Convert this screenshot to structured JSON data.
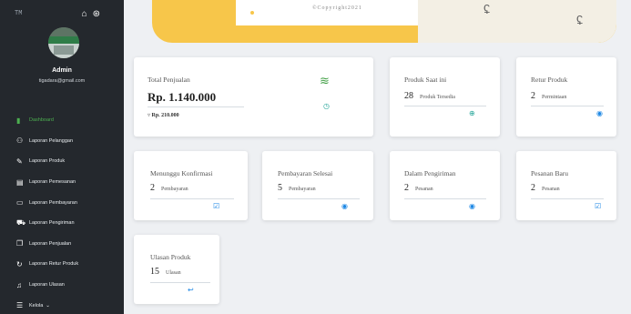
{
  "sidebar": {
    "brand": "TM",
    "top_icons": [
      "home-icon",
      "user-circle-icon"
    ],
    "user": {
      "name": "Admin",
      "email": "tigadara@gmail.com"
    },
    "items": [
      {
        "label": "Dashboard",
        "icon": "chart-bars-icon",
        "active": true
      },
      {
        "label": "Laporan Pelanggan",
        "icon": "users-icon"
      },
      {
        "label": "Laporan Produk",
        "icon": "edit-icon"
      },
      {
        "label": "Laporan Pemesanan",
        "icon": "file-icon"
      },
      {
        "label": "Laporan Pembayaran",
        "icon": "wallet-icon"
      },
      {
        "label": "Laporan Pengiriman",
        "icon": "truck-icon"
      },
      {
        "label": "Laporan Penjualan",
        "icon": "copy-icon"
      },
      {
        "label": "Laporan Retur Produk",
        "icon": "refresh-icon"
      },
      {
        "label": "Laporan Ulasan",
        "icon": "bell-icon"
      },
      {
        "label": "Kelola",
        "icon": "list-icon",
        "suffix": "⌄"
      }
    ]
  },
  "banner": {
    "copyright": "©Copyright2021"
  },
  "cards": {
    "total_penjualan": {
      "title": "Total Penjualan",
      "value": "Rp. 1.140.000",
      "sub": "Rp. 210.000"
    },
    "produk": {
      "title": "Produk Saat ini",
      "value": "28",
      "unit": "Produk Tersedia"
    },
    "retur": {
      "title": "Retur Produk",
      "value": "2",
      "unit": "Permintaan"
    },
    "menunggu": {
      "title": "Menunggu Konfirmasi",
      "value": "2",
      "unit": "Pembayaran"
    },
    "pembayaran": {
      "title": "Pembayaran Selesai",
      "value": "5",
      "unit": "Pembayaran"
    },
    "pengiriman": {
      "title": "Dalam Pengiriman",
      "value": "2",
      "unit": "Pesanan"
    },
    "pesanan_baru": {
      "title": "Pesanan Baru",
      "value": "2",
      "unit": "Pesanan"
    },
    "ulasan": {
      "title": "Ulasan Produk",
      "value": "15",
      "unit": "Ulasan"
    }
  },
  "colors": {
    "sidebar": "#24282d",
    "accent_green": "#4caf50",
    "banner": "#f7c64a",
    "link_blue": "#1e88e5"
  }
}
